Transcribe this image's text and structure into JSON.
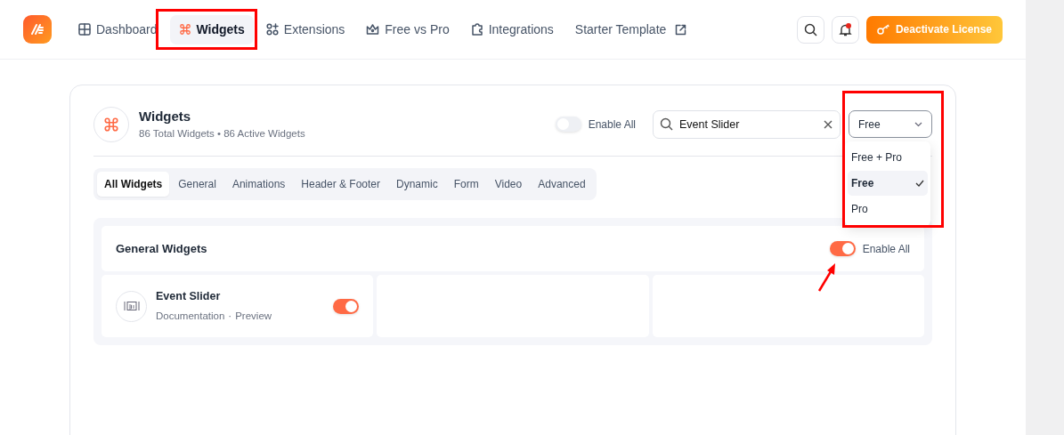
{
  "nav": {
    "items": [
      {
        "label": "Dashboard",
        "selected": false,
        "external": false
      },
      {
        "label": "Widgets",
        "selected": true,
        "external": false
      },
      {
        "label": "Extensions",
        "selected": false,
        "external": false
      },
      {
        "label": "Free vs Pro",
        "selected": false,
        "external": false
      },
      {
        "label": "Integrations",
        "selected": false,
        "external": false
      },
      {
        "label": "Starter Template",
        "selected": false,
        "external": true
      }
    ],
    "notification_dot": true,
    "license_button": "Deactivate License"
  },
  "header": {
    "title": "Widgets",
    "subtitle": "86 Total Widgets • 86 Active Widgets",
    "enable_all": {
      "label": "Enable All",
      "on": false
    },
    "search": {
      "value": "Event Slider"
    },
    "filter": {
      "value": "Free",
      "expanded": true,
      "options": [
        {
          "label": "Free + Pro",
          "selected": false
        },
        {
          "label": "Free",
          "selected": true
        },
        {
          "label": "Pro",
          "selected": false
        }
      ]
    }
  },
  "tabs": [
    {
      "label": "All Widgets",
      "selected": true
    },
    {
      "label": "General",
      "selected": false
    },
    {
      "label": "Animations",
      "selected": false
    },
    {
      "label": "Header & Footer",
      "selected": false
    },
    {
      "label": "Dynamic",
      "selected": false
    },
    {
      "label": "Form",
      "selected": false
    },
    {
      "label": "Video",
      "selected": false
    },
    {
      "label": "Advanced",
      "selected": false
    }
  ],
  "section": {
    "title": "General Widgets",
    "enable_all": {
      "label": "Enable All",
      "on": true
    },
    "widgets": [
      {
        "name": "Event Slider",
        "links": [
          "Documentation",
          "Preview"
        ],
        "link_separator": "·",
        "on": true
      }
    ]
  }
}
